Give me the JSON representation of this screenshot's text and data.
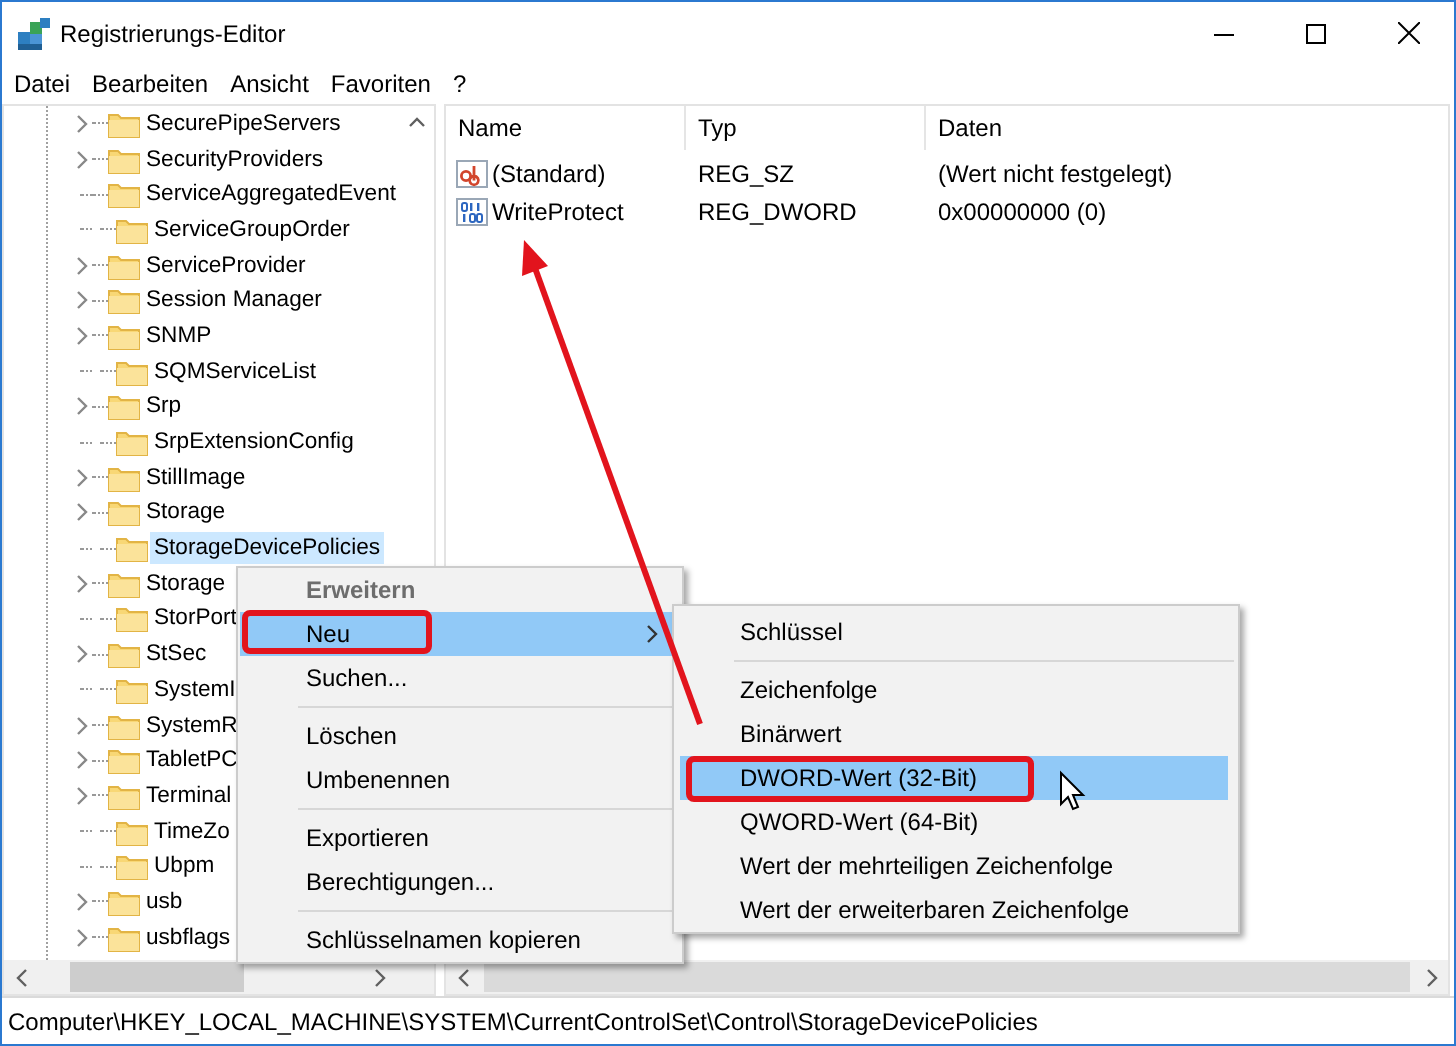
{
  "window": {
    "title": "Registrierungs-Editor"
  },
  "menu_bar": [
    "Datei",
    "Bearbeiten",
    "Ansicht",
    "Favoriten",
    "?"
  ],
  "tree": {
    "items": [
      {
        "label": "SecurePipeServers",
        "expandable": true,
        "selected": false
      },
      {
        "label": "SecurityProviders",
        "expandable": true,
        "selected": false
      },
      {
        "label": "ServiceAggregatedEvent",
        "expandable": false,
        "selected": false
      },
      {
        "label": "ServiceGroupOrder",
        "expandable": false,
        "selected": false
      },
      {
        "label": "ServiceProvider",
        "expandable": true,
        "selected": false
      },
      {
        "label": "Session Manager",
        "expandable": true,
        "selected": false
      },
      {
        "label": "SNMP",
        "expandable": true,
        "selected": false
      },
      {
        "label": "SQMServiceList",
        "expandable": false,
        "selected": false
      },
      {
        "label": "Srp",
        "expandable": true,
        "selected": false
      },
      {
        "label": "SrpExtensionConfig",
        "expandable": false,
        "selected": false
      },
      {
        "label": "StillImage",
        "expandable": true,
        "selected": false
      },
      {
        "label": "Storage",
        "expandable": true,
        "selected": false
      },
      {
        "label": "StorageDevicePolicies",
        "expandable": false,
        "selected": true
      },
      {
        "label": "Storage",
        "expandable": true,
        "selected": false
      },
      {
        "label": "StorPort",
        "expandable": false,
        "selected": false
      },
      {
        "label": "StSec",
        "expandable": true,
        "selected": false
      },
      {
        "label": "SystemI",
        "expandable": false,
        "selected": false
      },
      {
        "label": "SystemR",
        "expandable": true,
        "selected": false
      },
      {
        "label": "TabletPC",
        "expandable": true,
        "selected": false
      },
      {
        "label": "Terminal",
        "expandable": true,
        "selected": false
      },
      {
        "label": "TimeZo",
        "expandable": false,
        "selected": false
      },
      {
        "label": "Ubpm",
        "expandable": false,
        "selected": false
      },
      {
        "label": "usb",
        "expandable": true,
        "selected": false
      },
      {
        "label": "usbflags",
        "expandable": true,
        "selected": false
      }
    ]
  },
  "values": {
    "columns": [
      "Name",
      "Typ",
      "Daten"
    ],
    "rows": [
      {
        "kind": "string",
        "name": "(Standard)",
        "type": "REG_SZ",
        "data": "(Wert nicht festgelegt)"
      },
      {
        "kind": "binary",
        "name": "WriteProtect",
        "type": "REG_DWORD",
        "data": "0x00000000 (0)"
      }
    ]
  },
  "context_menu": {
    "items": [
      {
        "kind": "item",
        "label": "Erweitern",
        "default": true,
        "disabled": true,
        "submenu": false,
        "selected": false,
        "circled": false
      },
      {
        "kind": "item",
        "label": "Neu",
        "default": false,
        "disabled": false,
        "submenu": true,
        "selected": true,
        "circled": true
      },
      {
        "kind": "item",
        "label": "Suchen...",
        "default": false,
        "disabled": false,
        "submenu": false,
        "selected": false,
        "circled": false
      },
      {
        "kind": "separator"
      },
      {
        "kind": "item",
        "label": "Löschen",
        "default": false,
        "disabled": false,
        "submenu": false,
        "selected": false,
        "circled": false
      },
      {
        "kind": "item",
        "label": "Umbenennen",
        "default": false,
        "disabled": false,
        "submenu": false,
        "selected": false,
        "circled": false
      },
      {
        "kind": "separator"
      },
      {
        "kind": "item",
        "label": "Exportieren",
        "default": false,
        "disabled": false,
        "submenu": false,
        "selected": false,
        "circled": false
      },
      {
        "kind": "item",
        "label": "Berechtigungen...",
        "default": false,
        "disabled": false,
        "submenu": false,
        "selected": false,
        "circled": false
      },
      {
        "kind": "separator"
      },
      {
        "kind": "item",
        "label": "Schlüsselnamen kopieren",
        "default": false,
        "disabled": false,
        "submenu": false,
        "selected": false,
        "circled": false
      }
    ]
  },
  "submenu": {
    "items": [
      {
        "kind": "item",
        "label": "Schlüssel",
        "selected": false,
        "circled": false
      },
      {
        "kind": "separator"
      },
      {
        "kind": "item",
        "label": "Zeichenfolge",
        "selected": false,
        "circled": false
      },
      {
        "kind": "item",
        "label": "Binärwert",
        "selected": false,
        "circled": false
      },
      {
        "kind": "item",
        "label": "DWORD-Wert (32-Bit)",
        "selected": true,
        "circled": true
      },
      {
        "kind": "item",
        "label": "QWORD-Wert (64-Bit)",
        "selected": false,
        "circled": false
      },
      {
        "kind": "item",
        "label": "Wert der mehrteiligen Zeichenfolge",
        "selected": false,
        "circled": false
      },
      {
        "kind": "item",
        "label": "Wert der erweiterbaren Zeichenfolge",
        "selected": false,
        "circled": false
      }
    ]
  },
  "annotation_arrow": true,
  "status_bar": "Computer\\HKEY_LOCAL_MACHINE\\SYSTEM\\CurrentControlSet\\Control\\StorageDevicePolicies"
}
